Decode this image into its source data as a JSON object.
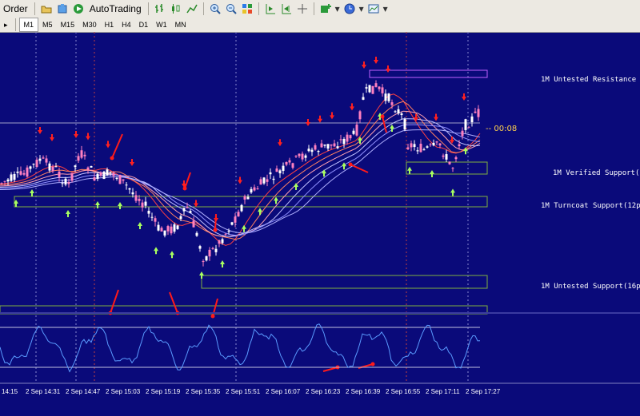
{
  "toolbar": {
    "order_label": "Order",
    "autotrading_label": "AutoTrading",
    "timeframes": [
      "M1",
      "M5",
      "M15",
      "M30",
      "H1",
      "H4",
      "D1",
      "W1",
      "MN"
    ],
    "selected_timeframe": "M1"
  },
  "chart": {
    "timer": "-- 00:08",
    "levels": [
      {
        "label": "1M Untested Resistance",
        "top_price": 1.07,
        "bottom_price": 1.068
      },
      {
        "label": "1M Verified Support(",
        "top_price": 1.048,
        "bottom_price": 1.046
      },
      {
        "label": "1M Turncoat Support(12p",
        "top_price": 1.04,
        "bottom_price": 1.038
      },
      {
        "label": "1M Untested Support(16p",
        "top_price": 1.023,
        "bottom_price": 1.021
      }
    ],
    "time_labels": [
      "14:15",
      "2 Sep 14:31",
      "2 Sep 14:47",
      "2 Sep 15:03",
      "2 Sep 15:19",
      "2 Sep 15:35",
      "2 Sep 15:51",
      "2 Sep 16:07",
      "2 Sep 16:23",
      "2 Sep 16:39",
      "2 Sep 16:55",
      "2 Sep 17:11",
      "2 Sep 17:27"
    ],
    "colors": {
      "background": "#0a0a7a",
      "bull": "#ffffff",
      "bear": "#ff80c0",
      "up_arrow": "#a8ff60",
      "down_arrow": "#ff2020",
      "oscillator": "#5a9bff"
    }
  }
}
